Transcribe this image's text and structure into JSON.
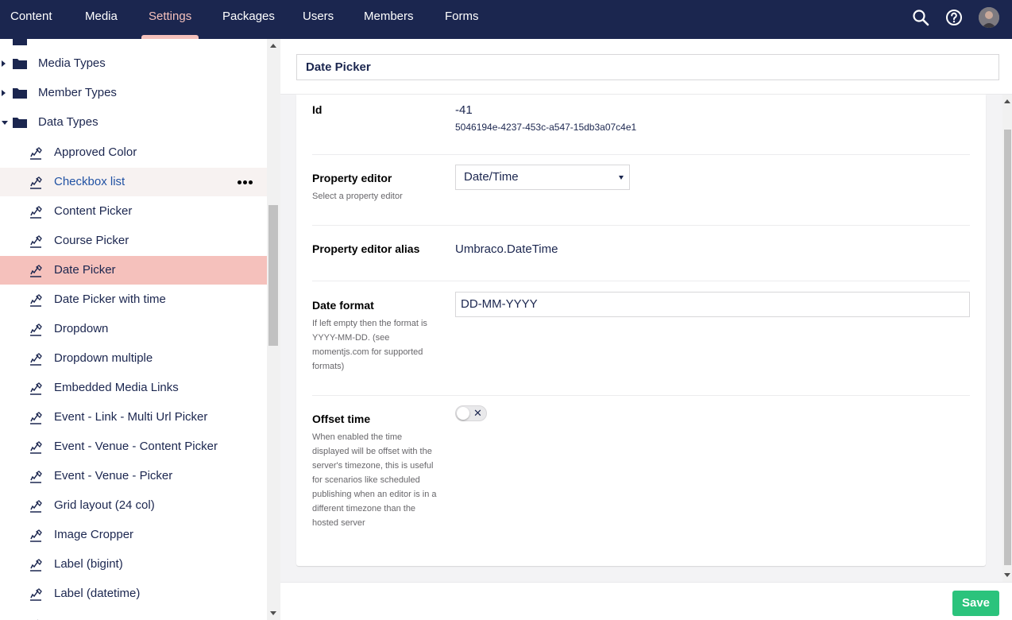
{
  "nav": {
    "items": [
      {
        "label": "Content"
      },
      {
        "label": "Media"
      },
      {
        "label": "Settings",
        "active": true
      },
      {
        "label": "Packages"
      },
      {
        "label": "Users"
      },
      {
        "label": "Members"
      },
      {
        "label": "Forms"
      }
    ],
    "icons": [
      "search-icon",
      "help-icon",
      "user-avatar"
    ]
  },
  "tree": {
    "folders": [
      {
        "label": "Media Types",
        "expanded": false
      },
      {
        "label": "Member Types",
        "expanded": false
      },
      {
        "label": "Data Types",
        "expanded": true
      }
    ],
    "items": [
      {
        "label": "Approved Color"
      },
      {
        "label": "Checkbox list",
        "hover": true
      },
      {
        "label": "Content Picker"
      },
      {
        "label": "Course Picker"
      },
      {
        "label": "Date Picker",
        "selected": true
      },
      {
        "label": "Date Picker with time"
      },
      {
        "label": "Dropdown"
      },
      {
        "label": "Dropdown multiple"
      },
      {
        "label": "Embedded Media Links"
      },
      {
        "label": "Event - Link - Multi Url Picker"
      },
      {
        "label": "Event - Venue - Content Picker"
      },
      {
        "label": "Event - Venue - Picker"
      },
      {
        "label": "Grid layout (24 col)"
      },
      {
        "label": "Image Cropper"
      },
      {
        "label": "Label (bigint)"
      },
      {
        "label": "Label (datetime)"
      }
    ]
  },
  "editor": {
    "name": "Date Picker",
    "id": {
      "label": "Id",
      "value": "-41",
      "guid": "5046194e-4237-453c-a547-15db3a07c4e1"
    },
    "property_editor": {
      "label": "Property editor",
      "description": "Select a property editor",
      "value": "Date/Time"
    },
    "property_editor_alias": {
      "label": "Property editor alias",
      "value": "Umbraco.DateTime"
    },
    "date_format": {
      "label": "Date format",
      "description": "If left empty then the format is YYYY-MM-DD. (see momentjs.com for supported formats)",
      "value": "DD-MM-YYYY"
    },
    "offset_time": {
      "label": "Offset time",
      "description": "When enabled the time displayed will be offset with the server's timezone, this is useful for scenarios like scheduled publishing when an editor is in a different timezone than the hosted server",
      "enabled": false,
      "toggle_off_glyph": "✕"
    }
  },
  "footer": {
    "save_label": "Save"
  },
  "colors": {
    "nav_bg": "#1b264f",
    "accent": "#f5c1bc",
    "save": "#2bc37c"
  }
}
